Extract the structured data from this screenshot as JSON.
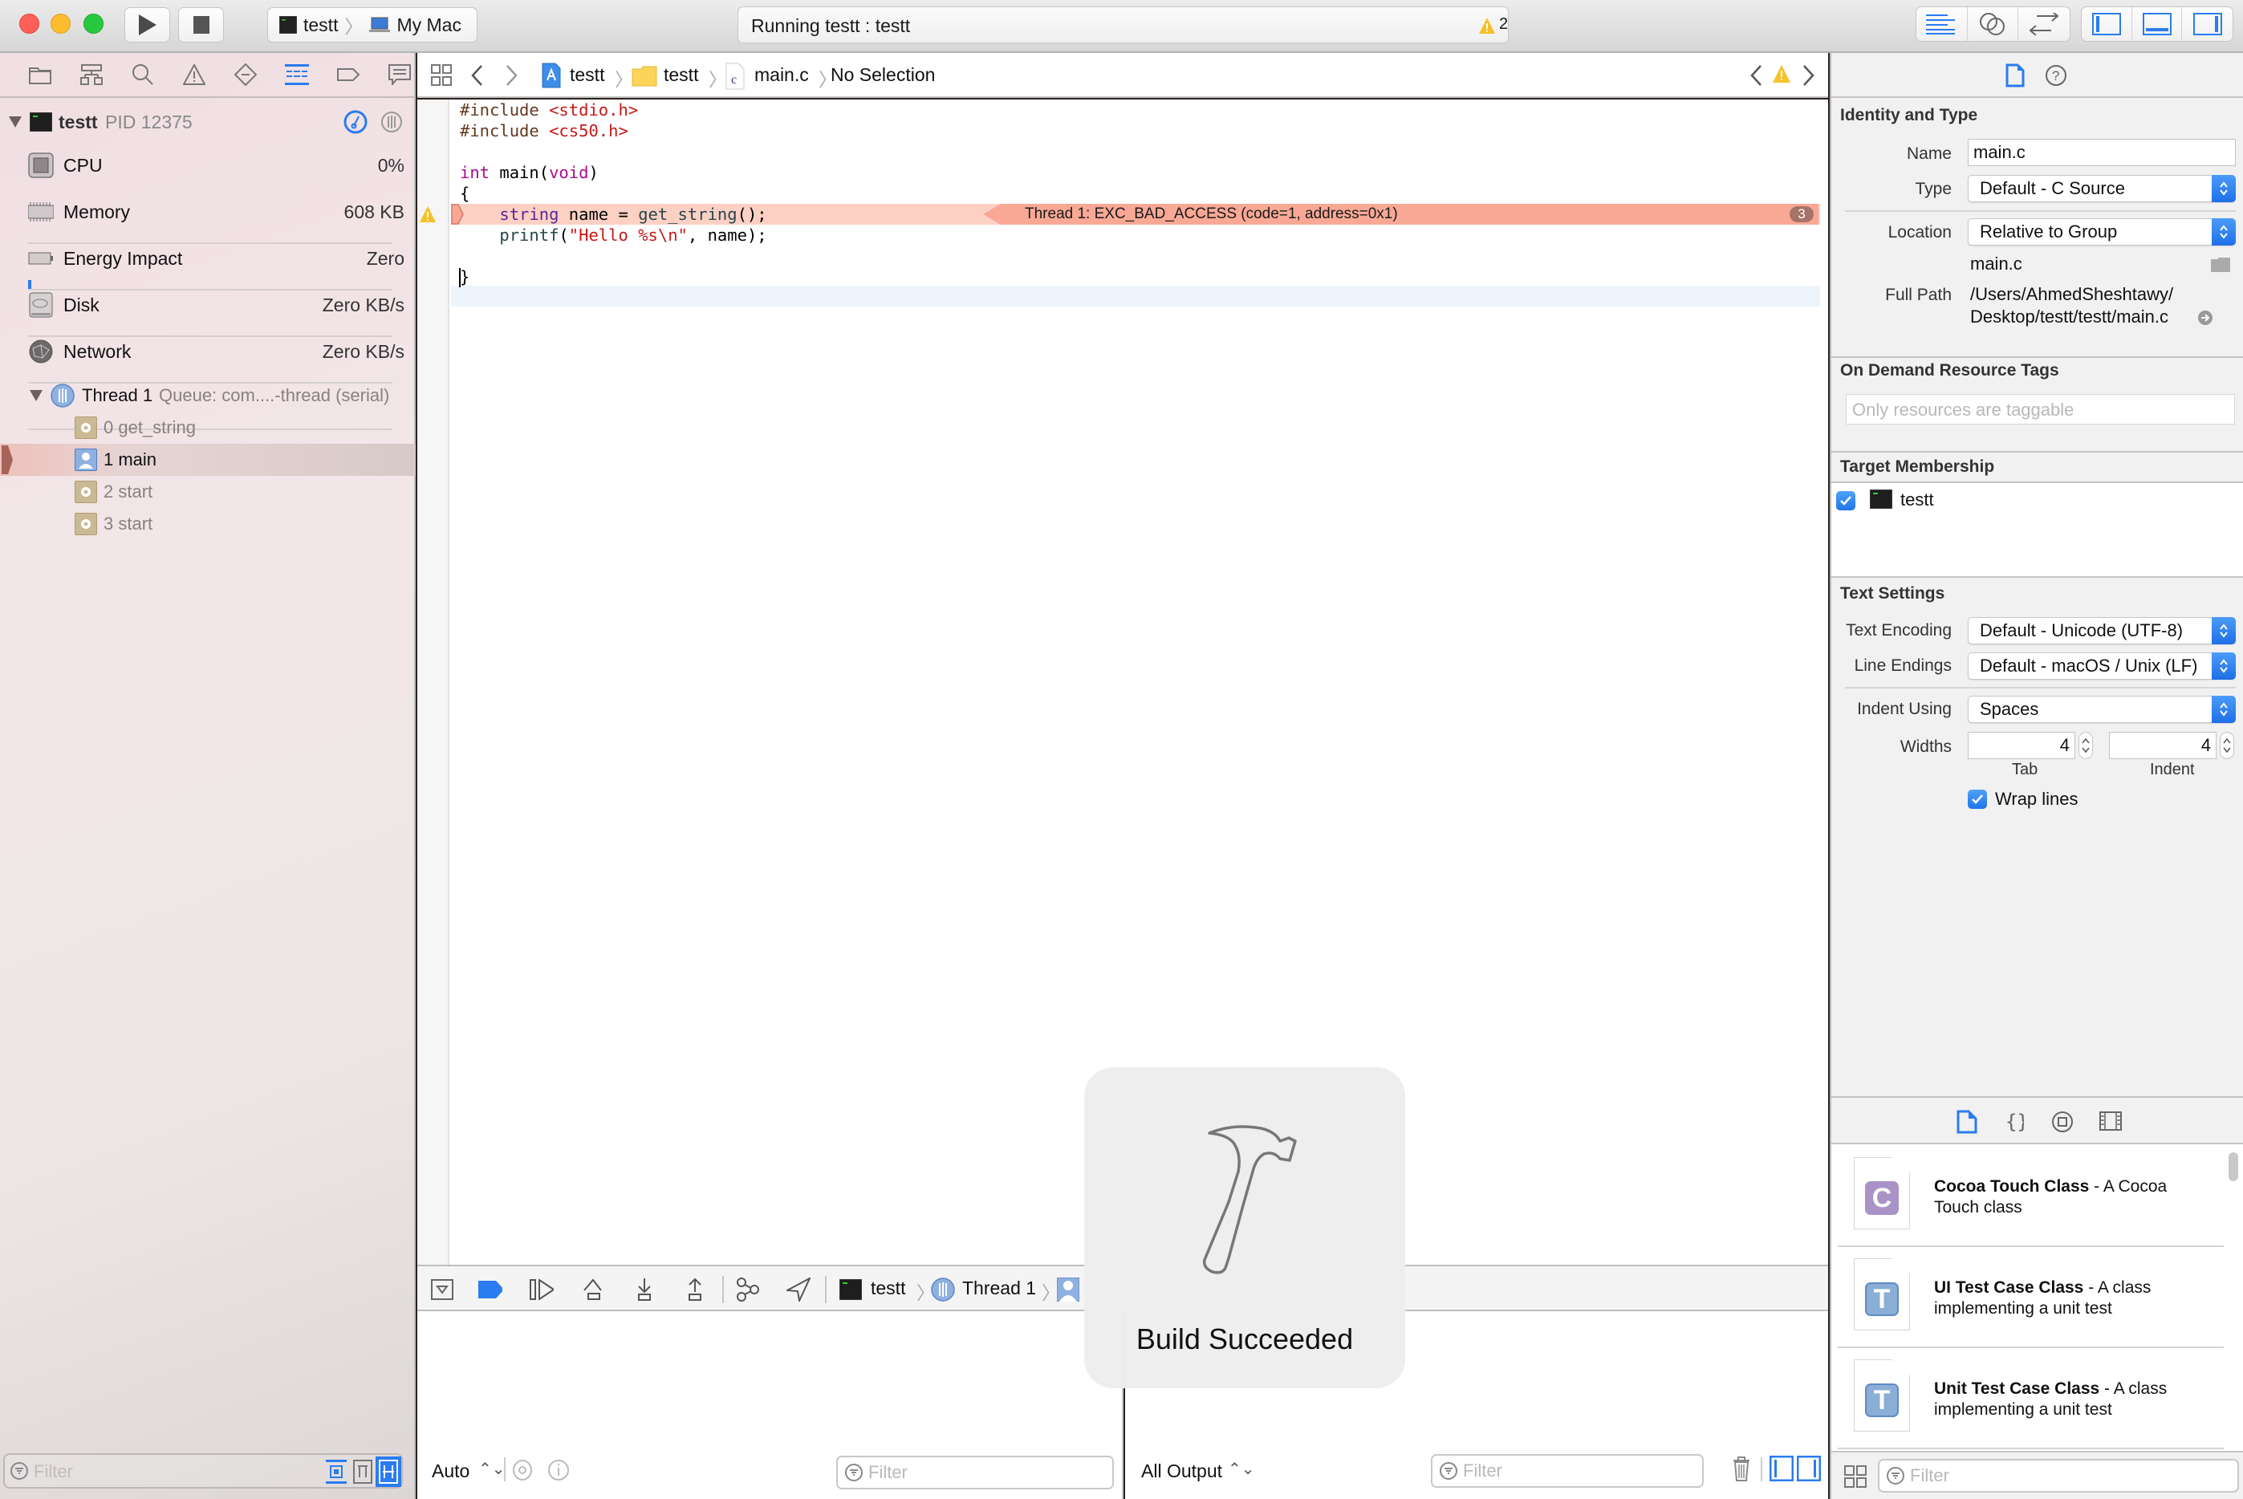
{
  "window": {
    "traffic_lights": {
      "close": "#fe5f57",
      "minimize": "#febc2e",
      "zoom": "#28c840"
    },
    "accent_color": "#1f7cf2"
  },
  "toolbar": {
    "run_icon": "play-icon",
    "stop_icon": "stop-icon",
    "scheme": {
      "target": "testt",
      "destination": "My Mac"
    },
    "activity": {
      "status": "Running testt : testt",
      "warning_count": "2"
    },
    "editor_modes": [
      "standard-editor-icon",
      "assistant-editor-icon",
      "version-editor-icon"
    ],
    "view_toggles": [
      "navigator-toggle-icon",
      "debug-area-toggle-icon",
      "utilities-toggle-icon"
    ]
  },
  "navigator": {
    "tabs": [
      "project",
      "symbol",
      "find",
      "issue",
      "test",
      "debug",
      "breakpoint",
      "report"
    ],
    "active_tab": "debug",
    "process": {
      "name": "testt",
      "pid": "PID 12375"
    },
    "gauges": [
      {
        "label": "CPU",
        "value": "0%",
        "icon": "cpu-icon"
      },
      {
        "label": "Memory",
        "value": "608 KB",
        "icon": "memory-icon"
      },
      {
        "label": "Energy Impact",
        "value": "Zero",
        "icon": "battery-icon"
      },
      {
        "label": "Disk",
        "value": "Zero KB/s",
        "icon": "disk-icon"
      },
      {
        "label": "Network",
        "value": "Zero KB/s",
        "icon": "network-icon"
      }
    ],
    "thread": {
      "name": "Thread 1",
      "queue": "Queue: com....-thread (serial)"
    },
    "frames": [
      {
        "label": "0 get_string",
        "kind": "system",
        "selected": false
      },
      {
        "label": "1 main",
        "kind": "user",
        "selected": true
      },
      {
        "label": "2 start",
        "kind": "system",
        "selected": false
      },
      {
        "label": "3 start",
        "kind": "system",
        "selected": false
      }
    ],
    "filter_placeholder": "Filter"
  },
  "jumpbar": {
    "crumbs": [
      "testt",
      "testt",
      "main.c",
      "No Selection"
    ]
  },
  "editor": {
    "lines": [
      "#include <stdio.h>",
      "#include <cs50.h>",
      "",
      "int main(void)",
      "{",
      "    string name = get_string();",
      "    printf(\"Hello %s\\n\", name);",
      "",
      "}"
    ],
    "error_line": 6,
    "error_message": "Thread 1: EXC_BAD_ACCESS (code=1, address=0x1)",
    "error_badge": "3"
  },
  "debug_bar": {
    "crumbs": [
      "testt",
      "Thread 1"
    ]
  },
  "console": {
    "left_mode": "Auto",
    "right_mode": "All Output",
    "filter_placeholder": "Filter"
  },
  "hud": {
    "label": "Build Succeeded",
    "icon": "hammer-icon"
  },
  "inspector": {
    "identity": {
      "title": "Identity and Type",
      "name_label": "Name",
      "name_value": "main.c",
      "type_label": "Type",
      "type_value": "Default - C Source",
      "location_label": "Location",
      "location_value": "Relative to Group",
      "location_file": "main.c",
      "fullpath_label": "Full Path",
      "fullpath_line1": "/Users/AhmedSheshtawy/",
      "fullpath_line2": "Desktop/testt/testt/main.c"
    },
    "odr": {
      "title": "On Demand Resource Tags",
      "placeholder": "Only resources are taggable"
    },
    "target": {
      "title": "Target Membership",
      "targets": [
        {
          "name": "testt",
          "checked": true
        }
      ]
    },
    "text_settings": {
      "title": "Text Settings",
      "encoding_label": "Text Encoding",
      "encoding_value": "Default - Unicode (UTF-8)",
      "endings_label": "Line Endings",
      "endings_value": "Default - macOS / Unix (LF)",
      "indent_label": "Indent Using",
      "indent_value": "Spaces",
      "widths_label": "Widths",
      "tab_width": "4",
      "indent_width": "4",
      "tab_caption": "Tab",
      "indent_caption": "Indent",
      "wrap_label": "Wrap lines",
      "wrap_checked": true
    }
  },
  "library": {
    "tabs": [
      "file-template-icon",
      "code-snippet-icon",
      "object-icon",
      "media-icon"
    ],
    "items": [
      {
        "title": "Cocoa Touch Class",
        "desc": " - A Cocoa Touch class",
        "badge": "C",
        "badge_color": "#a892c6"
      },
      {
        "title": "UI Test Case Class",
        "desc": " - A class implementing a unit test",
        "badge": "T",
        "badge_color": "#8aaed6"
      },
      {
        "title": "Unit Test Case Class",
        "desc": " - A class implementing a unit test",
        "badge": "T",
        "badge_color": "#8aaed6"
      }
    ],
    "filter_placeholder": "Filter"
  }
}
